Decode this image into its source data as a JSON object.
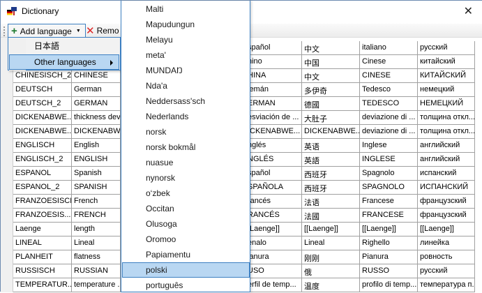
{
  "window": {
    "title": "Dictionary",
    "close_icon": "close-icon"
  },
  "toolbar": {
    "add_language": "Add language",
    "remove_label": "Remo"
  },
  "add_menu": {
    "items": [
      "日本語",
      "Other languages"
    ],
    "highlighted": 1
  },
  "submenu": {
    "items": [
      "Malti",
      "Mapudungun",
      "Melayu",
      "meta'",
      "MUNDAŊ",
      "Nda'a",
      "Neddersass'sch",
      "Nederlands",
      "norsk",
      "norsk bokmål",
      "nuasue",
      "nynorsk",
      "o‘zbek",
      "Occitan",
      "Olusoga",
      "Oromoo",
      "Papiamentu",
      "polski",
      "português"
    ],
    "highlighted": 17
  },
  "grid": {
    "rows": [
      [
        "",
        "",
        "spañol",
        "中文",
        "italiano",
        "русский"
      ],
      [
        "",
        "",
        "hino",
        "中国",
        "Cinese",
        "китайский"
      ],
      [
        "CHINESISCH_2",
        "CHINESE",
        "HINA",
        "中文",
        "CINESE",
        "КИТАЙСКИЙ"
      ],
      [
        "DEUTSCH",
        "German",
        "lemán",
        "多伊奇",
        "Tedesco",
        "немецкий"
      ],
      [
        "DEUTSCH_2",
        "GERMAN",
        "ERMAN",
        "德國",
        "TEDESCO",
        "НЕМЕЦКИЙ"
      ],
      [
        "DICKENABWE...",
        "thickness devi",
        "esviación de ...",
        "大肚子",
        "deviazione di ...",
        "толщина откл..."
      ],
      [
        "DICKENABWE...",
        "DICKENABWE",
        "ICKENABWE...",
        "DICKENABWE...",
        "deviazione di ...",
        "толщина откл..."
      ],
      [
        "ENGLISCH",
        "English",
        "nglés",
        "英语",
        "Inglese",
        "английский"
      ],
      [
        "ENGLISCH_2",
        "ENGLISH",
        "NGLÉS",
        "英語",
        "INGLESE",
        "английский"
      ],
      [
        "ESPANOL",
        "Spanish",
        "spañol",
        "西班牙",
        "Spagnolo",
        "испанский"
      ],
      [
        "ESPANOL_2",
        "SPANISH",
        "SPAÑOLA",
        "西班牙",
        "SPAGNOLO",
        "ИСПАНСКИЙ"
      ],
      [
        "FRANZOESISCH",
        "French",
        "rancés",
        "法语",
        "Francese",
        "французский"
      ],
      [
        "FRANZOESIS...",
        "FRENCH",
        "RANCÉS",
        "法國",
        "FRANCESE",
        "французский"
      ],
      [
        "Laenge",
        "length",
        "[Laenge]]",
        "[[Laenge]]",
        "[[Laenge]]",
        "[[Laenge]]"
      ],
      [
        "LINEAL",
        "Lineal",
        "enalo",
        "Lineal",
        "Righello",
        "линейка"
      ],
      [
        "PLANHEIT",
        "flatness",
        "lanura",
        "刚刚",
        "Pianura",
        "ровность"
      ],
      [
        "RUSSISCH",
        "RUSSIAN",
        "USO",
        "俄",
        "RUSSO",
        "русский"
      ],
      [
        "TEMPERATUR...",
        "temperature ...",
        "erfil de temp...",
        "温度",
        "profilo di temp...",
        "температура п..."
      ]
    ]
  },
  "colors": {
    "accent": "#3c7fc1",
    "highlight": "#b9d7f2"
  }
}
